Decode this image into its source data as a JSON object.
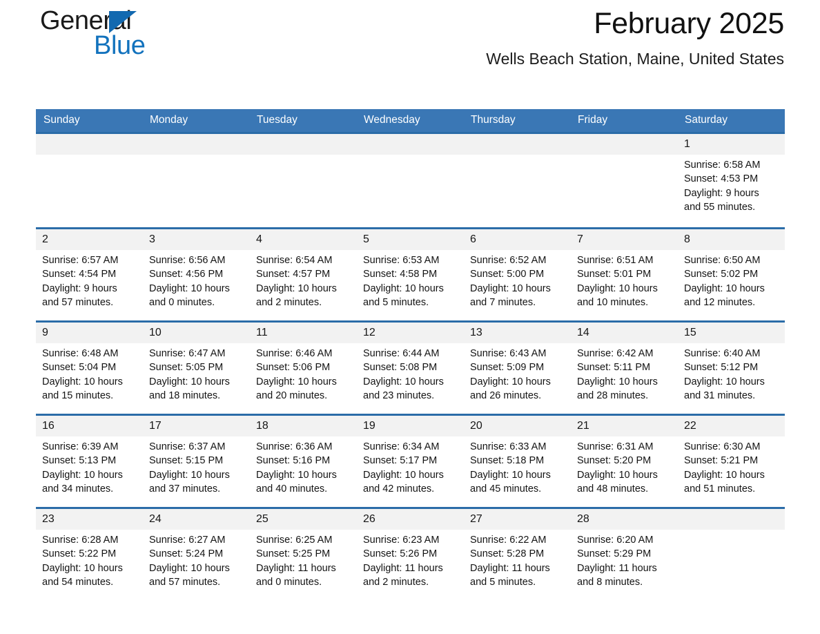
{
  "brand": {
    "name_part1": "General",
    "name_part2": "Blue",
    "logo_icon": "triangle-flag-icon",
    "accent_color": "#1272bd"
  },
  "header": {
    "month_title": "February 2025",
    "location": "Wells Beach Station, Maine, United States"
  },
  "calendar": {
    "header_bg": "#3a77b5",
    "row_divider_color": "#2b6ca8",
    "daynum_bg": "#f2f2f2",
    "weekday_headers": [
      "Sunday",
      "Monday",
      "Tuesday",
      "Wednesday",
      "Thursday",
      "Friday",
      "Saturday"
    ],
    "weeks": [
      [
        {
          "day": "",
          "details": ""
        },
        {
          "day": "",
          "details": ""
        },
        {
          "day": "",
          "details": ""
        },
        {
          "day": "",
          "details": ""
        },
        {
          "day": "",
          "details": ""
        },
        {
          "day": "",
          "details": ""
        },
        {
          "day": "1",
          "details": "Sunrise: 6:58 AM\nSunset: 4:53 PM\nDaylight: 9 hours and 55 minutes."
        }
      ],
      [
        {
          "day": "2",
          "details": "Sunrise: 6:57 AM\nSunset: 4:54 PM\nDaylight: 9 hours and 57 minutes."
        },
        {
          "day": "3",
          "details": "Sunrise: 6:56 AM\nSunset: 4:56 PM\nDaylight: 10 hours and 0 minutes."
        },
        {
          "day": "4",
          "details": "Sunrise: 6:54 AM\nSunset: 4:57 PM\nDaylight: 10 hours and 2 minutes."
        },
        {
          "day": "5",
          "details": "Sunrise: 6:53 AM\nSunset: 4:58 PM\nDaylight: 10 hours and 5 minutes."
        },
        {
          "day": "6",
          "details": "Sunrise: 6:52 AM\nSunset: 5:00 PM\nDaylight: 10 hours and 7 minutes."
        },
        {
          "day": "7",
          "details": "Sunrise: 6:51 AM\nSunset: 5:01 PM\nDaylight: 10 hours and 10 minutes."
        },
        {
          "day": "8",
          "details": "Sunrise: 6:50 AM\nSunset: 5:02 PM\nDaylight: 10 hours and 12 minutes."
        }
      ],
      [
        {
          "day": "9",
          "details": "Sunrise: 6:48 AM\nSunset: 5:04 PM\nDaylight: 10 hours and 15 minutes."
        },
        {
          "day": "10",
          "details": "Sunrise: 6:47 AM\nSunset: 5:05 PM\nDaylight: 10 hours and 18 minutes."
        },
        {
          "day": "11",
          "details": "Sunrise: 6:46 AM\nSunset: 5:06 PM\nDaylight: 10 hours and 20 minutes."
        },
        {
          "day": "12",
          "details": "Sunrise: 6:44 AM\nSunset: 5:08 PM\nDaylight: 10 hours and 23 minutes."
        },
        {
          "day": "13",
          "details": "Sunrise: 6:43 AM\nSunset: 5:09 PM\nDaylight: 10 hours and 26 minutes."
        },
        {
          "day": "14",
          "details": "Sunrise: 6:42 AM\nSunset: 5:11 PM\nDaylight: 10 hours and 28 minutes."
        },
        {
          "day": "15",
          "details": "Sunrise: 6:40 AM\nSunset: 5:12 PM\nDaylight: 10 hours and 31 minutes."
        }
      ],
      [
        {
          "day": "16",
          "details": "Sunrise: 6:39 AM\nSunset: 5:13 PM\nDaylight: 10 hours and 34 minutes."
        },
        {
          "day": "17",
          "details": "Sunrise: 6:37 AM\nSunset: 5:15 PM\nDaylight: 10 hours and 37 minutes."
        },
        {
          "day": "18",
          "details": "Sunrise: 6:36 AM\nSunset: 5:16 PM\nDaylight: 10 hours and 40 minutes."
        },
        {
          "day": "19",
          "details": "Sunrise: 6:34 AM\nSunset: 5:17 PM\nDaylight: 10 hours and 42 minutes."
        },
        {
          "day": "20",
          "details": "Sunrise: 6:33 AM\nSunset: 5:18 PM\nDaylight: 10 hours and 45 minutes."
        },
        {
          "day": "21",
          "details": "Sunrise: 6:31 AM\nSunset: 5:20 PM\nDaylight: 10 hours and 48 minutes."
        },
        {
          "day": "22",
          "details": "Sunrise: 6:30 AM\nSunset: 5:21 PM\nDaylight: 10 hours and 51 minutes."
        }
      ],
      [
        {
          "day": "23",
          "details": "Sunrise: 6:28 AM\nSunset: 5:22 PM\nDaylight: 10 hours and 54 minutes."
        },
        {
          "day": "24",
          "details": "Sunrise: 6:27 AM\nSunset: 5:24 PM\nDaylight: 10 hours and 57 minutes."
        },
        {
          "day": "25",
          "details": "Sunrise: 6:25 AM\nSunset: 5:25 PM\nDaylight: 11 hours and 0 minutes."
        },
        {
          "day": "26",
          "details": "Sunrise: 6:23 AM\nSunset: 5:26 PM\nDaylight: 11 hours and 2 minutes."
        },
        {
          "day": "27",
          "details": "Sunrise: 6:22 AM\nSunset: 5:28 PM\nDaylight: 11 hours and 5 minutes."
        },
        {
          "day": "28",
          "details": "Sunrise: 6:20 AM\nSunset: 5:29 PM\nDaylight: 11 hours and 8 minutes."
        },
        {
          "day": "",
          "details": ""
        }
      ]
    ]
  }
}
